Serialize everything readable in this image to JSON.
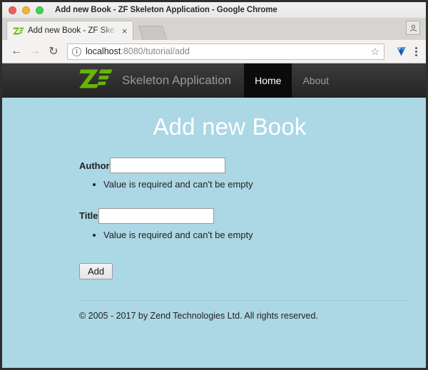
{
  "window": {
    "title": "Add new Book - ZF Skeleton Application - Google Chrome",
    "controls": {
      "close": "close-button",
      "minimize": "minimize-button",
      "maximize": "maximize-button"
    }
  },
  "browser": {
    "tab": {
      "title": "Add new Book - ZF Ske",
      "favicon": "zf-favicon",
      "close_label": "×"
    },
    "new_tab_label": "",
    "profile_icon": "person-icon",
    "toolbar": {
      "back_label": "←",
      "forward_label": "→",
      "reload_label": "↻",
      "site_info_label": "i",
      "url_host": "localhost",
      "url_rest": ":8080/tutorial/add",
      "url_full": "localhost:8080/tutorial/add",
      "url_placeholder": "Search Google or type a URL",
      "bookmark_label": "☆",
      "extension_icon": "diamond-extension-icon",
      "menu_label": "⋮"
    }
  },
  "page": {
    "navbar": {
      "logo": "zend-framework-logo",
      "brand": "Skeleton Application",
      "links": [
        {
          "label": "Home",
          "active": true
        },
        {
          "label": "About",
          "active": false
        }
      ]
    },
    "heading": "Add new Book",
    "form": {
      "fields": [
        {
          "label": "Author",
          "value": "",
          "placeholder": "",
          "errors": [
            "Value is required and can't be empty"
          ]
        },
        {
          "label": "Title",
          "value": "",
          "placeholder": "",
          "errors": [
            "Value is required and can't be empty"
          ]
        }
      ],
      "submit_label": "Add"
    },
    "footer": "© 2005 - 2017 by Zend Technologies Ltd. All rights reserved."
  },
  "colors": {
    "page_background": "#acd7e5",
    "navbar_top": "#3c3c3c",
    "navbar_bottom": "#242424",
    "nav_active_background": "#0b0b0b",
    "logo_green": "#68b604",
    "heading_white": "#ffffff"
  }
}
